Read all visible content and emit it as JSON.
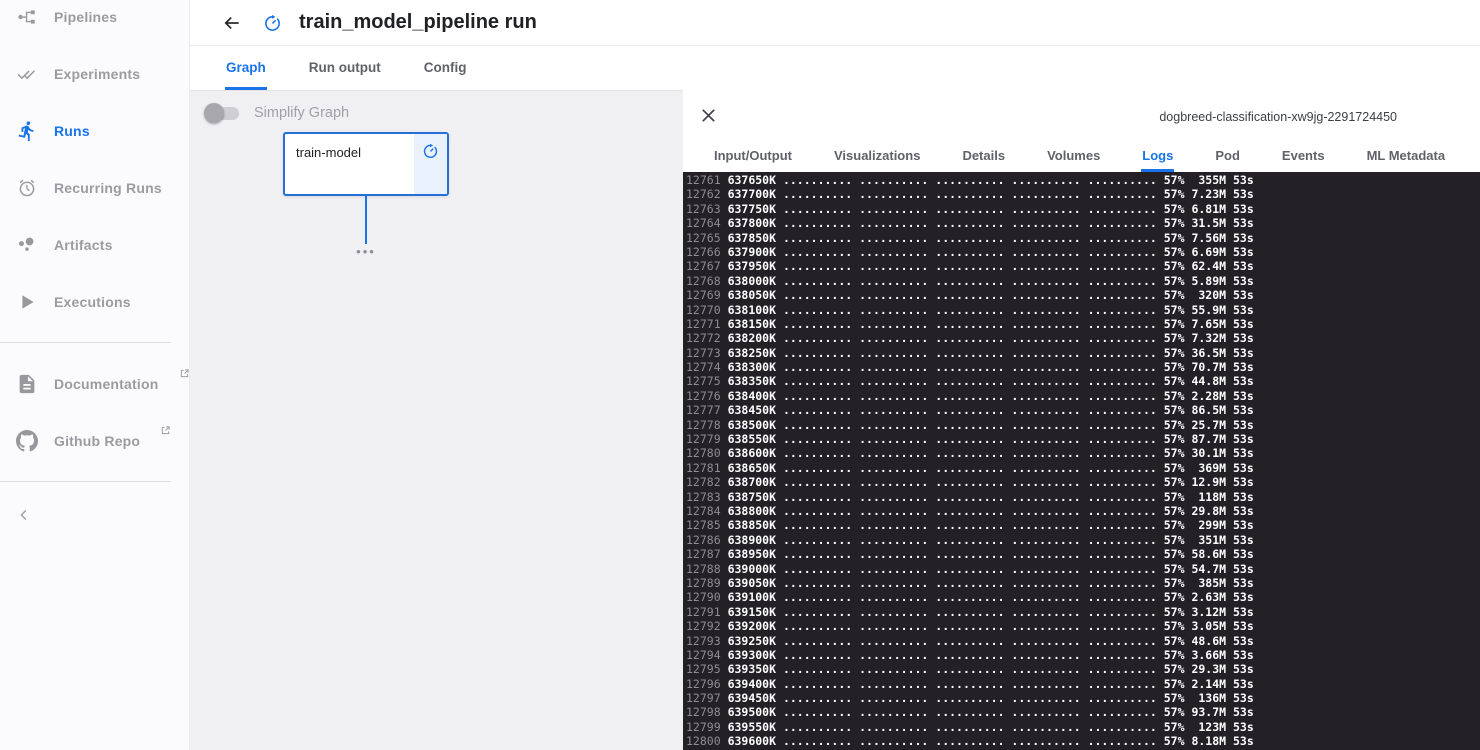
{
  "colors": {
    "accent": "#1a73e8",
    "log_background": "#232126",
    "log_text": "#ffffff",
    "log_line_number": "#8f8d94",
    "node_border": "#2470d8",
    "node_status_bg": "#e9f1fc",
    "graph_background": "#f0eff2"
  },
  "sidebar": {
    "items": [
      {
        "label": "Pipelines",
        "icon": "pipelines-icon",
        "active": false,
        "external": false
      },
      {
        "label": "Experiments",
        "icon": "experiments-icon",
        "active": false,
        "external": false
      },
      {
        "label": "Runs",
        "icon": "runs-icon",
        "active": true,
        "external": false
      },
      {
        "label": "Recurring Runs",
        "icon": "recurring-runs-icon",
        "active": false,
        "external": false
      },
      {
        "label": "Artifacts",
        "icon": "artifacts-icon",
        "active": false,
        "external": false
      },
      {
        "label": "Executions",
        "icon": "executions-icon",
        "active": false,
        "external": false
      },
      {
        "label": "Documentation",
        "icon": "documentation-icon",
        "active": false,
        "external": true
      },
      {
        "label": "Github Repo",
        "icon": "github-icon",
        "active": false,
        "external": true
      }
    ],
    "collapse_icon": "chevron-left-icon"
  },
  "header": {
    "title": "train_model_pipeline run",
    "back_icon": "arrow-back-icon",
    "status_icon": "status-running-icon"
  },
  "run_tabs": [
    {
      "label": "Graph",
      "active": true
    },
    {
      "label": "Run output",
      "active": false
    },
    {
      "label": "Config",
      "active": false
    }
  ],
  "graph": {
    "simplify_toggle_label": "Simplify Graph",
    "toggle_on": false,
    "node": {
      "label": "train-model",
      "status": "running"
    },
    "more_nodes_dots": "•••"
  },
  "panel": {
    "close_icon": "close-icon",
    "title": "dogbreed-classification-xw9jg-2291724450",
    "tabs": [
      {
        "label": "Input/Output",
        "active": false
      },
      {
        "label": "Visualizations",
        "active": false
      },
      {
        "label": "Details",
        "active": false
      },
      {
        "label": "Volumes",
        "active": false
      },
      {
        "label": "Logs",
        "active": true
      },
      {
        "label": "Pod",
        "active": false
      },
      {
        "label": "Events",
        "active": false
      },
      {
        "label": "ML Metadata",
        "active": false
      }
    ]
  },
  "logs": {
    "dots": ".......... .......... .......... .......... ..........",
    "lines": [
      {
        "num": 12761,
        "bytes": "637650K",
        "percent": "57%",
        "speed": "355M",
        "eta": "53s"
      },
      {
        "num": 12762,
        "bytes": "637700K",
        "percent": "57%",
        "speed": "7.23M",
        "eta": "53s"
      },
      {
        "num": 12763,
        "bytes": "637750K",
        "percent": "57%",
        "speed": "6.81M",
        "eta": "53s"
      },
      {
        "num": 12764,
        "bytes": "637800K",
        "percent": "57%",
        "speed": "31.5M",
        "eta": "53s"
      },
      {
        "num": 12765,
        "bytes": "637850K",
        "percent": "57%",
        "speed": "7.56M",
        "eta": "53s"
      },
      {
        "num": 12766,
        "bytes": "637900K",
        "percent": "57%",
        "speed": "6.69M",
        "eta": "53s"
      },
      {
        "num": 12767,
        "bytes": "637950K",
        "percent": "57%",
        "speed": "62.4M",
        "eta": "53s"
      },
      {
        "num": 12768,
        "bytes": "638000K",
        "percent": "57%",
        "speed": "5.89M",
        "eta": "53s"
      },
      {
        "num": 12769,
        "bytes": "638050K",
        "percent": "57%",
        "speed": "320M",
        "eta": "53s"
      },
      {
        "num": 12770,
        "bytes": "638100K",
        "percent": "57%",
        "speed": "55.9M",
        "eta": "53s"
      },
      {
        "num": 12771,
        "bytes": "638150K",
        "percent": "57%",
        "speed": "7.65M",
        "eta": "53s"
      },
      {
        "num": 12772,
        "bytes": "638200K",
        "percent": "57%",
        "speed": "7.32M",
        "eta": "53s"
      },
      {
        "num": 12773,
        "bytes": "638250K",
        "percent": "57%",
        "speed": "36.5M",
        "eta": "53s"
      },
      {
        "num": 12774,
        "bytes": "638300K",
        "percent": "57%",
        "speed": "70.7M",
        "eta": "53s"
      },
      {
        "num": 12775,
        "bytes": "638350K",
        "percent": "57%",
        "speed": "44.8M",
        "eta": "53s"
      },
      {
        "num": 12776,
        "bytes": "638400K",
        "percent": "57%",
        "speed": "2.28M",
        "eta": "53s"
      },
      {
        "num": 12777,
        "bytes": "638450K",
        "percent": "57%",
        "speed": "86.5M",
        "eta": "53s"
      },
      {
        "num": 12778,
        "bytes": "638500K",
        "percent": "57%",
        "speed": "25.7M",
        "eta": "53s"
      },
      {
        "num": 12779,
        "bytes": "638550K",
        "percent": "57%",
        "speed": "87.7M",
        "eta": "53s"
      },
      {
        "num": 12780,
        "bytes": "638600K",
        "percent": "57%",
        "speed": "30.1M",
        "eta": "53s"
      },
      {
        "num": 12781,
        "bytes": "638650K",
        "percent": "57%",
        "speed": "369M",
        "eta": "53s"
      },
      {
        "num": 12782,
        "bytes": "638700K",
        "percent": "57%",
        "speed": "12.9M",
        "eta": "53s"
      },
      {
        "num": 12783,
        "bytes": "638750K",
        "percent": "57%",
        "speed": "118M",
        "eta": "53s"
      },
      {
        "num": 12784,
        "bytes": "638800K",
        "percent": "57%",
        "speed": "29.8M",
        "eta": "53s"
      },
      {
        "num": 12785,
        "bytes": "638850K",
        "percent": "57%",
        "speed": "299M",
        "eta": "53s"
      },
      {
        "num": 12786,
        "bytes": "638900K",
        "percent": "57%",
        "speed": "351M",
        "eta": "53s"
      },
      {
        "num": 12787,
        "bytes": "638950K",
        "percent": "57%",
        "speed": "58.6M",
        "eta": "53s"
      },
      {
        "num": 12788,
        "bytes": "639000K",
        "percent": "57%",
        "speed": "54.7M",
        "eta": "53s"
      },
      {
        "num": 12789,
        "bytes": "639050K",
        "percent": "57%",
        "speed": "385M",
        "eta": "53s"
      },
      {
        "num": 12790,
        "bytes": "639100K",
        "percent": "57%",
        "speed": "2.63M",
        "eta": "53s"
      },
      {
        "num": 12791,
        "bytes": "639150K",
        "percent": "57%",
        "speed": "3.12M",
        "eta": "53s"
      },
      {
        "num": 12792,
        "bytes": "639200K",
        "percent": "57%",
        "speed": "3.05M",
        "eta": "53s"
      },
      {
        "num": 12793,
        "bytes": "639250K",
        "percent": "57%",
        "speed": "48.6M",
        "eta": "53s"
      },
      {
        "num": 12794,
        "bytes": "639300K",
        "percent": "57%",
        "speed": "3.66M",
        "eta": "53s"
      },
      {
        "num": 12795,
        "bytes": "639350K",
        "percent": "57%",
        "speed": "29.3M",
        "eta": "53s"
      },
      {
        "num": 12796,
        "bytes": "639400K",
        "percent": "57%",
        "speed": "2.14M",
        "eta": "53s"
      },
      {
        "num": 12797,
        "bytes": "639450K",
        "percent": "57%",
        "speed": "136M",
        "eta": "53s"
      },
      {
        "num": 12798,
        "bytes": "639500K",
        "percent": "57%",
        "speed": "93.7M",
        "eta": "53s"
      },
      {
        "num": 12799,
        "bytes": "639550K",
        "percent": "57%",
        "speed": "123M",
        "eta": "53s"
      },
      {
        "num": 12800,
        "bytes": "639600K",
        "percent": "57%",
        "speed": "8.18M",
        "eta": "53s"
      }
    ]
  }
}
